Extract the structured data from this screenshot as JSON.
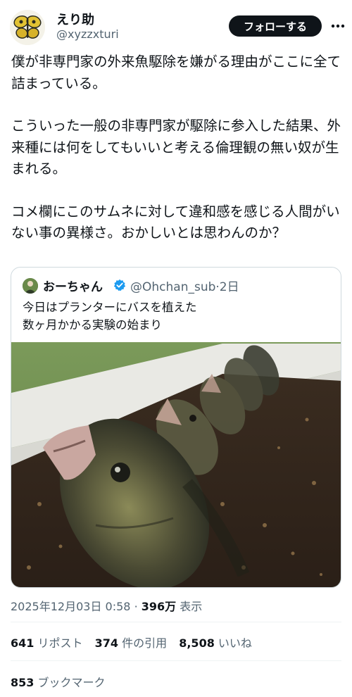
{
  "author": {
    "display_name": "えり助",
    "handle": "@xyzzxturi"
  },
  "follow_label": "フォローする",
  "tweet_paragraphs": [
    "僕が非専門家の外来魚駆除を嫌がる理由がここに全て詰まっている。",
    "こういった一般の非専門家が駆除に参入した結果、外来種には何をしてもいいと考える倫理観の無い奴が生まれる。",
    "コメ欄にこのサムネに対して違和感を感じる人間がいない事の異様さ。おかしいとは思わんのか？"
  ],
  "quoted_tweet": {
    "display_name": "おーちゃん",
    "handle": "@Ohchan_sub",
    "separator": "·",
    "time": "2日",
    "lines": [
      "今日はプランターにバスを植えた",
      "数ヶ月かかる実験の始まり"
    ]
  },
  "meta": {
    "timestamp": "2025年12月03日 0:58",
    "separator": "·",
    "views_count": "396万",
    "views_label": "表示"
  },
  "stats": {
    "reposts_count": "641",
    "reposts_label": "リポスト",
    "quotes_count": "374",
    "quotes_label": "件の引用",
    "likes_count": "8,508",
    "likes_label": "いいね",
    "bookmarks_count": "853",
    "bookmarks_label": "ブックマーク"
  },
  "colors": {
    "text": "#0f1419",
    "secondary": "#536471",
    "border": "#cfd9de",
    "verified": "#1d9bf0",
    "follow_bg": "#0f1419"
  }
}
